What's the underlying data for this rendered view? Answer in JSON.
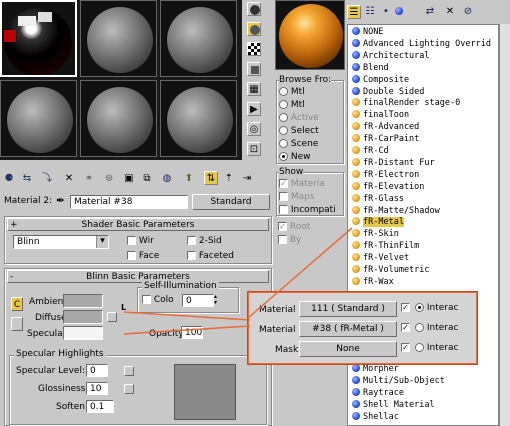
{
  "toolbar": {
    "material_label": "Material 2:",
    "material_name": "Material #38",
    "material_type": "Standard"
  },
  "shader": {
    "title": "Shader Basic Parameters",
    "shader_type": "Blinn",
    "wire": "Wir",
    "two_sided": "2-Sid",
    "face": "Face",
    "faceted": "Faceted"
  },
  "blinn": {
    "title": "Blinn Basic Parameters",
    "self_illum_title": "Self-Illumination",
    "color_label": "Colo",
    "color_value": "0",
    "ambient": "Ambient:",
    "diffuse": "Diffuse:",
    "specular": "Specular:",
    "opacity_label": "Opacity:",
    "opacity_value": "100",
    "lock": "L",
    "c_button": "C"
  },
  "spec_highlights": {
    "title": "Specular Highlights",
    "level_label": "Specular Level:",
    "level_value": "0",
    "gloss_label": "Glossiness:",
    "gloss_value": "10",
    "soften_label": "Soften:",
    "soften_value": "0.1"
  },
  "browse": {
    "title": "Browse Fro:",
    "options": [
      "Mtl",
      "Mtl",
      "Active",
      "Select",
      "Scene",
      "New"
    ],
    "show_title": "Show",
    "show_options": [
      "Materia",
      "Maps",
      "Incompati",
      "Root",
      "By"
    ]
  },
  "material_list": [
    {
      "name": "NONE",
      "color": "blue"
    },
    {
      "name": "Advanced Lighting Overrid",
      "color": "blue"
    },
    {
      "name": "Architectural",
      "color": "blue"
    },
    {
      "name": "Blend",
      "color": "blue"
    },
    {
      "name": "Composite",
      "color": "blue"
    },
    {
      "name": "Double Sided",
      "color": "blue"
    },
    {
      "name": "finalRender stage-0",
      "color": "gold"
    },
    {
      "name": "finalToon",
      "color": "gold"
    },
    {
      "name": "fR-Advanced",
      "color": "gold"
    },
    {
      "name": "fR-CarPaint",
      "color": "gold"
    },
    {
      "name": "fR-Cd",
      "color": "gold"
    },
    {
      "name": "fR-Distant Fur",
      "color": "gold"
    },
    {
      "name": "fR-Electron",
      "color": "gold"
    },
    {
      "name": "fR-Elevation",
      "color": "gold"
    },
    {
      "name": "fR-Glass",
      "color": "gold"
    },
    {
      "name": "fR-Matte/Shadow",
      "color": "gold"
    },
    {
      "name": "fR-Metal",
      "color": "gold",
      "selected": true
    },
    {
      "name": "fR-Skin",
      "color": "gold"
    },
    {
      "name": "fR-ThinFilm",
      "color": "gold"
    },
    {
      "name": "fR-Velvet",
      "color": "gold"
    },
    {
      "name": "fR-Volumetric",
      "color": "gold"
    },
    {
      "name": "fR-Wax",
      "color": "gold"
    }
  ],
  "material_list_bottom": [
    {
      "name": "Morpher",
      "color": "blue"
    },
    {
      "name": "Multi/Sub-Object",
      "color": "blue"
    },
    {
      "name": "Raytrace",
      "color": "blue"
    },
    {
      "name": "Shell Material",
      "color": "blue"
    },
    {
      "name": "Shellac",
      "color": "blue"
    }
  ],
  "callout": {
    "mat1_label": "Material 1:",
    "mat1_value": "111  ( Standard )",
    "mat2_label": "Material 2:",
    "mat2_value": "#38    ( fR-Metal )",
    "mask_label": "Mask:",
    "mask_value": "None",
    "interac": "Interac"
  },
  "colors": {
    "accent_callout": "#e86a3a",
    "selection": "#e6c84a"
  }
}
